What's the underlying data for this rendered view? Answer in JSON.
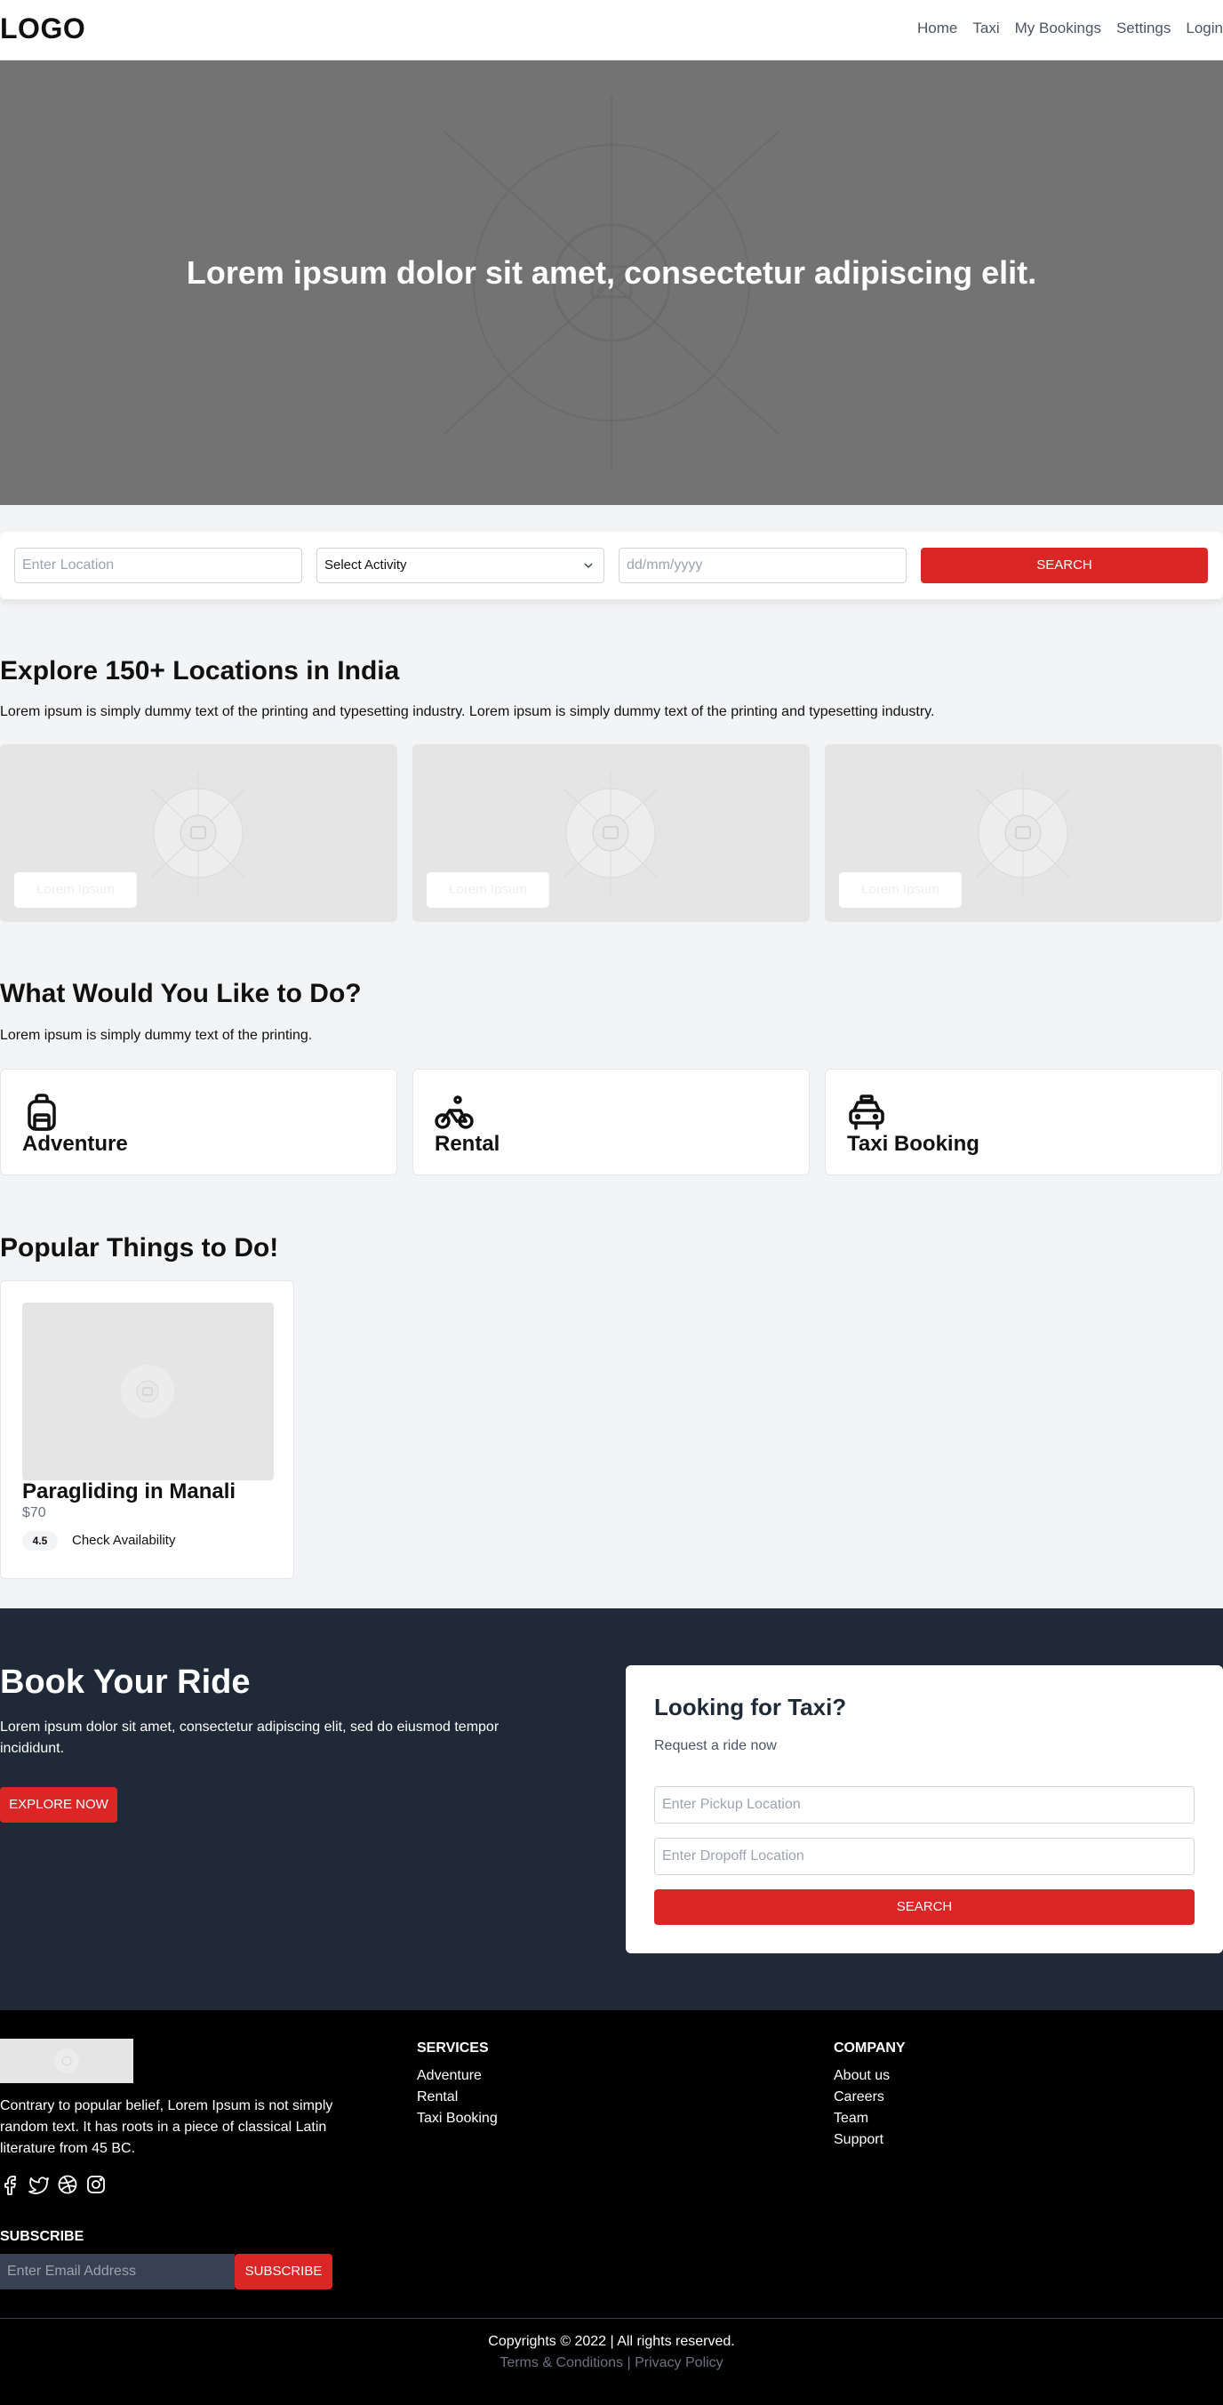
{
  "header": {
    "logo": "LOGO",
    "nav": [
      "Home",
      "Taxi",
      "My Bookings",
      "Settings",
      "Login"
    ]
  },
  "hero": {
    "title": "Lorem ipsum dolor sit amet, consectetur adipiscing elit."
  },
  "search": {
    "location_placeholder": "Enter Location",
    "activity_selected": "Select Activity",
    "date_placeholder": "dd/mm/yyyy",
    "button": "SEARCH"
  },
  "explore": {
    "title": "Explore 150+ Locations in India",
    "subtitle": "Lorem ipsum is simply dummy text of the printing and typesetting industry. Lorem ipsum is simply dummy text of the printing and typesetting industry.",
    "cards": [
      {
        "label": "Lorem Ipsum"
      },
      {
        "label": "Lorem Ipsum"
      },
      {
        "label": "Lorem Ipsum"
      }
    ]
  },
  "activities": {
    "title": "What Would You Like to Do?",
    "subtitle": "Lorem ipsum is simply dummy text of the printing.",
    "items": [
      {
        "label": "Adventure",
        "icon": "backpack-icon"
      },
      {
        "label": "Rental",
        "icon": "bicycle-icon"
      },
      {
        "label": "Taxi Booking",
        "icon": "taxi-icon"
      }
    ]
  },
  "popular": {
    "title": "Popular Things to Do!",
    "items": [
      {
        "title": "Paragliding in Manali",
        "price": "$70",
        "rating": "4.5",
        "action": "Check Availability"
      }
    ]
  },
  "book": {
    "title": "Book Your Ride",
    "description": "Lorem ipsum dolor sit amet, consectetur adipiscing elit, sed do eiusmod tempor incididunt.",
    "explore_button": "EXPLORE NOW",
    "taxi": {
      "title": "Looking for Taxi?",
      "subtitle": "Request a ride now",
      "pickup_placeholder": "Enter Pickup Location",
      "dropoff_placeholder": "Enter Dropoff Location",
      "button": "SEARCH"
    }
  },
  "footer": {
    "about": "Contrary to popular belief, Lorem Ipsum is not simply random text. It has roots in a piece of classical Latin literature from 45 BC.",
    "social": [
      "facebook-icon",
      "twitter-icon",
      "dribbble-icon",
      "instagram-icon"
    ],
    "services": {
      "title": "SERVICES",
      "items": [
        "Adventure",
        "Rental",
        "Taxi Booking"
      ]
    },
    "company": {
      "title": "COMPANY",
      "items": [
        "About us",
        "Careers",
        "Team",
        "Support"
      ]
    },
    "subscribe": {
      "title": "SUBSCRIBE",
      "placeholder": "Enter Email Address",
      "button": "SUBSCRIBE"
    },
    "copyright": "Copyrights © 2022 | All rights reserved.",
    "terms": "Terms & Conditions",
    "separator": "|",
    "privacy": "Privacy Policy"
  },
  "colors": {
    "accent": "#dc2626",
    "dark": "#1f2937",
    "footer": "#000000"
  }
}
